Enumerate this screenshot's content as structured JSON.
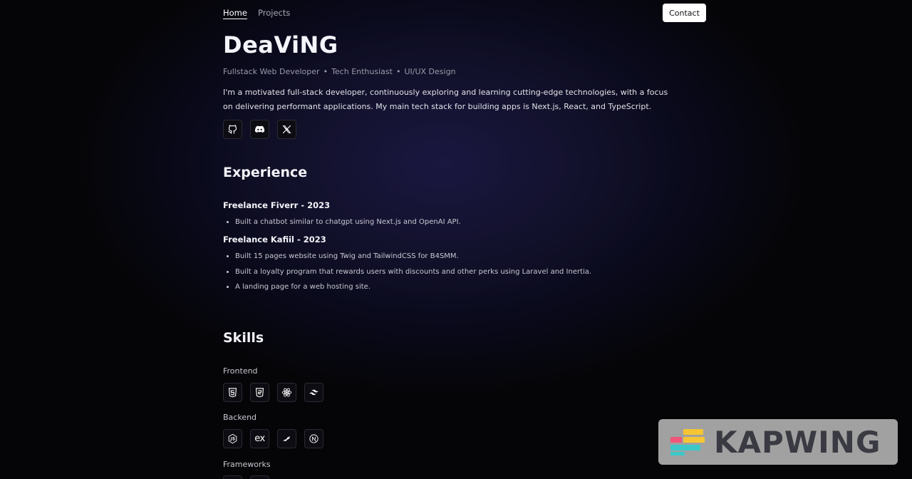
{
  "nav": {
    "home": "Home",
    "projects": "Projects",
    "contact": "Contact"
  },
  "hero": {
    "name": "DeaViNG",
    "roles": [
      "Fullstack Web Developer",
      "Tech Enthusiast",
      "UI/UX Design"
    ],
    "bio": "I'm a motivated full-stack developer, continuously exploring and learning cutting-edge technologies, with a focus on delivering performant applications. My main tech stack for building apps is Next.js, React, and TypeScript.",
    "socials": [
      "github-icon",
      "discord-icon",
      "x-icon"
    ]
  },
  "experience": {
    "title": "Experience",
    "jobs": [
      {
        "title": "Freelance Fiverr - 2023",
        "bullets": [
          "Built a chatbot similar to chatgpt using Next.js and OpenAI API."
        ]
      },
      {
        "title": "Freelance Kafiil - 2023",
        "bullets": [
          "Built 15 pages website using Twig and TailwindCSS for B4SMM.",
          "Built a loyalty program that rewards users with discounts and other perks using Laravel and Inertia.",
          "A landing page for a web hosting site."
        ]
      }
    ]
  },
  "skills": {
    "title": "Skills",
    "frontend": {
      "label": "Frontend",
      "icons": [
        "html5-icon",
        "css3-icon",
        "react-icon",
        "tailwind-icon"
      ]
    },
    "backend": {
      "label": "Backend",
      "icons": [
        "nodejs-icon",
        "express-icon",
        "prisma-icon",
        "nextjs-icon"
      ],
      "express_text": "ex"
    },
    "frameworks": {
      "label": "Frameworks"
    }
  },
  "watermark": {
    "text": "KAPWING",
    "colors": {
      "yellow": "#f5c533",
      "pink": "#f0557a",
      "teal": "#3cc8c8"
    }
  }
}
